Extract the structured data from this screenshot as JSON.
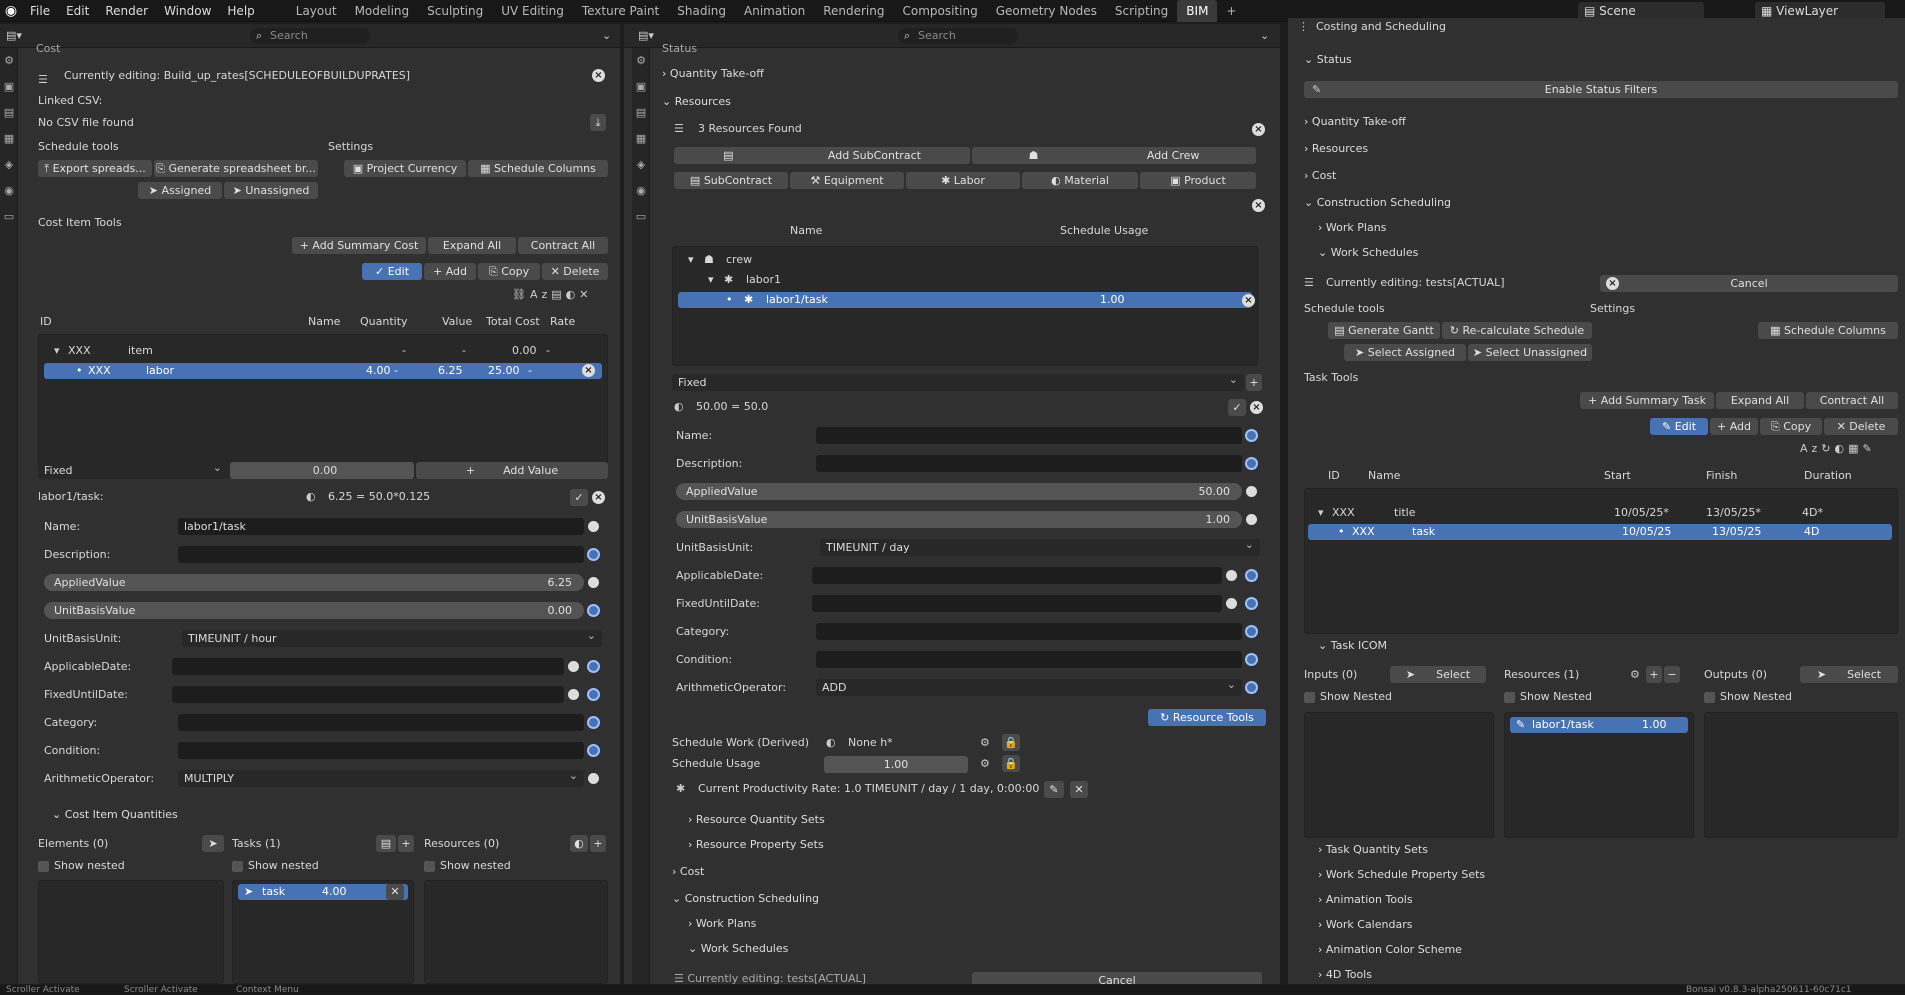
{
  "menu": [
    "File",
    "Edit",
    "Render",
    "Window",
    "Help"
  ],
  "workspaces": [
    "Layout",
    "Modeling",
    "Sculpting",
    "UV Editing",
    "Texture Paint",
    "Shading",
    "Animation",
    "Rendering",
    "Compositing",
    "Geometry Nodes",
    "Scripting",
    "BIM"
  ],
  "active_ws": "BIM",
  "scene": "Scene",
  "viewlayer": "ViewLayer",
  "search": "Search",
  "left": {
    "cost_header": "Cost",
    "editing": "Currently editing: Build_up_rates[SCHEDULEOFBUILDUPRATES]",
    "linked_csv": "Linked CSV:",
    "no_csv": "No CSV file found",
    "schedule_tools": "Schedule tools",
    "settings": "Settings",
    "export": "Export spreads...",
    "generate": "Generate spreadsheet br...",
    "project_currency": "Project Currency",
    "schedule_columns": "Schedule Columns",
    "assigned": "Assigned",
    "unassigned": "Unassigned",
    "cost_item_tools": "Cost Item Tools",
    "add_summary": "Add Summary Cost",
    "expand_all": "Expand All",
    "contract_all": "Contract All",
    "edit": "Edit",
    "add": "Add",
    "copy": "Copy",
    "delete": "Delete",
    "cols": {
      "id": "ID",
      "name": "Name",
      "quantity": "Quantity",
      "value": "Value",
      "total": "Total Cost",
      "rate": "Rate"
    },
    "row1": {
      "id": "XXX",
      "name": "item",
      "q": "-",
      "v": "-",
      "t": "0.00",
      "r": "-"
    },
    "row2": {
      "id": "XXX",
      "name": "labor",
      "q": "4.00 -",
      "v": "6.25",
      "t": "25.00",
      "r": "-"
    },
    "fixed": "Fixed",
    "zero": "0.00",
    "add_value": "Add Value",
    "task_label": "labor1/task:",
    "formula": "6.25 = 50.0*0.125",
    "name_l": "Name:",
    "name_v": "labor1/task",
    "desc_l": "Description:",
    "applied_l": "AppliedValue",
    "applied_v": "6.25",
    "ubv_l": "UnitBasisValue",
    "ubv_v": "0.00",
    "ubu_l": "UnitBasisUnit:",
    "ubu_v": "TIMEUNIT / hour",
    "appdate_l": "ApplicableDate:",
    "fixed_until_l": "FixedUntilDate:",
    "cat_l": "Category:",
    "cond_l": "Condition:",
    "arith_l": "ArithmeticOperator:",
    "arith_v": "MULTIPLY",
    "ciq": "Cost Item Quantities",
    "elements": "Elements (0)",
    "tasks": "Tasks (1)",
    "resources": "Resources (0)",
    "show_nested": "Show nested",
    "task_item": "task",
    "task_val": "4.00"
  },
  "mid": {
    "status": "Status",
    "qto": "Quantity Take-off",
    "resources": "Resources",
    "found": "3 Resources Found",
    "add_sub": "Add SubContract",
    "add_crew": "Add Crew",
    "types": [
      "SubContract",
      "Equipment",
      "Labor",
      "Material",
      "Product"
    ],
    "col_name": "Name",
    "col_usage": "Schedule Usage",
    "tree": [
      "crew",
      "labor1",
      "labor1/task"
    ],
    "usage": "1.00",
    "fixed": "Fixed",
    "formula": "50.00 = 50.0",
    "name_l": "Name:",
    "desc_l": "Description:",
    "applied_l": "AppliedValue",
    "applied_v": "50.00",
    "ubv_l": "UnitBasisValue",
    "ubv_v": "1.00",
    "ubu_l": "UnitBasisUnit:",
    "ubu_v": "TIMEUNIT / day",
    "appdate_l": "ApplicableDate:",
    "fixed_until_l": "FixedUntilDate:",
    "cat_l": "Category:",
    "cond_l": "Condition:",
    "arith_l": "ArithmeticOperator:",
    "arith_v": "ADD",
    "resource_tools": "Resource Tools",
    "sw_l": "Schedule Work  (Derived)",
    "sw_v": "None h*",
    "su_l": "Schedule Usage",
    "su_v": "1.00",
    "prod": "Current Productivity Rate: 1.0 TIMEUNIT / day / 1 day, 0:00:00",
    "rqs": "Resource Quantity Sets",
    "rps": "Resource Property Sets",
    "cost": "Cost",
    "cs": "Construction Scheduling",
    "wp": "Work Plans",
    "ws": "Work Schedules",
    "cut_editing": "Currently editing: tests[ACTUAL]",
    "cut_cancel": "Cancel"
  },
  "right": {
    "title": "Costing and Scheduling",
    "status": "Status",
    "enable_filters": "Enable Status Filters",
    "qto": "Quantity Take-off",
    "resources": "Resources",
    "cost": "Cost",
    "cs": "Construction Scheduling",
    "wp": "Work Plans",
    "ws": "Work Schedules",
    "editing": "Currently editing: tests[ACTUAL]",
    "cancel": "Cancel",
    "schedule_tools": "Schedule tools",
    "settings": "Settings",
    "gantt": "Generate Gantt",
    "recalc": "Re-calculate Schedule",
    "sched_cols": "Schedule Columns",
    "sel_assigned": "Select Assigned",
    "sel_unassigned": "Select Unassigned",
    "task_tools": "Task Tools",
    "add_summary": "Add Summary Task",
    "expand_all": "Expand All",
    "contract_all": "Contract All",
    "edit": "Edit",
    "add": "Add",
    "copy": "Copy",
    "delete": "Delete",
    "cols": {
      "id": "ID",
      "name": "Name",
      "start": "Start",
      "finish": "Finish",
      "duration": "Duration"
    },
    "row1": {
      "id": "XXX",
      "name": "title",
      "s": "10/05/25*",
      "f": "13/05/25*",
      "d": "4D*"
    },
    "row2": {
      "id": "XXX",
      "name": "task",
      "s": "10/05/25",
      "f": "13/05/25",
      "d": "4D"
    },
    "icom": "Task ICOM",
    "inputs": "Inputs (0)",
    "select": "Select",
    "res": "Resources (1)",
    "outputs": "Outputs (0)",
    "show_nested": "Show Nested",
    "res_item": "labor1/task",
    "res_val": "1.00",
    "tqs": "Task Quantity Sets",
    "wsps": "Work Schedule Property Sets",
    "anim": "Animation Tools",
    "cal": "Work Calendars",
    "acs": "Animation Color Scheme",
    "fourd": "4D Tools"
  },
  "status_bar": [
    "Scroller Activate",
    "Scroller Activate",
    "Context Menu"
  ],
  "version": "Bonsai v0.8.3-alpha250611-60c71c1"
}
